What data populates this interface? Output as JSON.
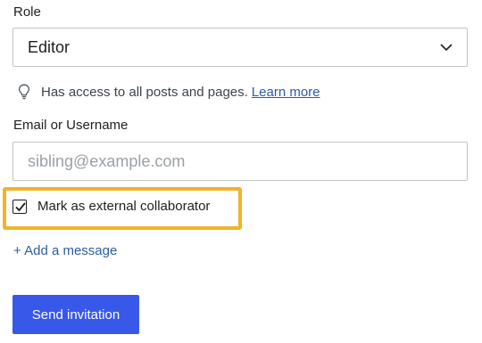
{
  "role": {
    "label": "Role",
    "selected": "Editor",
    "hint": "Has access to all posts and pages.",
    "hint_link": "Learn more"
  },
  "email": {
    "label": "Email or Username",
    "placeholder": "sibling@example.com",
    "value": ""
  },
  "external_collaborator": {
    "label": "Mark as external collaborator",
    "checked": true
  },
  "add_message": "+ Add a message",
  "send_button": "Send invitation",
  "colors": {
    "primary": "#3858e9",
    "link": "#2c5d9c",
    "highlight": "#f0b429",
    "border": "#c3c4c7"
  },
  "icons": {
    "select": "chevron-down-icon",
    "hint": "lightbulb-icon",
    "checkbox": "checkmark-icon"
  }
}
